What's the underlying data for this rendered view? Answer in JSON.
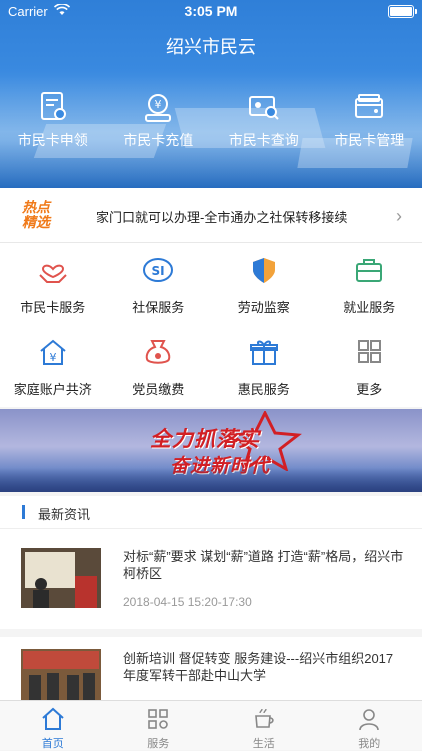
{
  "status": {
    "carrier": "Carrier",
    "time": "3:05 PM"
  },
  "header": {
    "title": "绍兴市民云"
  },
  "cards": [
    {
      "label": "市民卡申领",
      "icon": "card-apply-icon"
    },
    {
      "label": "市民卡充值",
      "icon": "card-recharge-icon"
    },
    {
      "label": "市民卡查询",
      "icon": "card-query-icon"
    },
    {
      "label": "市民卡管理",
      "icon": "card-manage-icon"
    }
  ],
  "hot": {
    "badge_line1": "热点",
    "badge_line2": "精选",
    "text": "家门口就可以办理-全市通办之社保转移接续"
  },
  "services": [
    {
      "label": "市民卡服务",
      "icon": "heart-hand-icon"
    },
    {
      "label": "社保服务",
      "icon": "si-logo-icon"
    },
    {
      "label": "劳动监察",
      "icon": "shield-icon"
    },
    {
      "label": "就业服务",
      "icon": "briefcase-icon"
    },
    {
      "label": "家庭账户共济",
      "icon": "yuan-house-icon"
    },
    {
      "label": "党员缴费",
      "icon": "party-bag-icon"
    },
    {
      "label": "惠民服务",
      "icon": "gift-icon"
    },
    {
      "label": "更多",
      "icon": "more-grid-icon"
    }
  ],
  "banner": {
    "line1": "全力抓落实",
    "line2": "奋进新时代"
  },
  "news": {
    "header": "最新资讯",
    "items": [
      {
        "title": "对标“薪”要求 谋划“薪”道路 打造“薪”格局，绍兴市柯桥区",
        "date": "2018-04-15 15:20-17:30"
      },
      {
        "title": "创新培训 督促转变 服务建设---绍兴市组织2017年度军转干部赴中山大学",
        "date": ""
      }
    ]
  },
  "tabs": [
    {
      "label": "首页",
      "icon": "home-icon",
      "active": true
    },
    {
      "label": "服务",
      "icon": "services-grid-icon",
      "active": false
    },
    {
      "label": "生活",
      "icon": "coffee-cup-icon",
      "active": false
    },
    {
      "label": "我的",
      "icon": "user-icon",
      "active": false
    }
  ],
  "colors": {
    "primary": "#2d7ad6",
    "hot": "#f07a1a",
    "banner_text": "#d21f24"
  }
}
